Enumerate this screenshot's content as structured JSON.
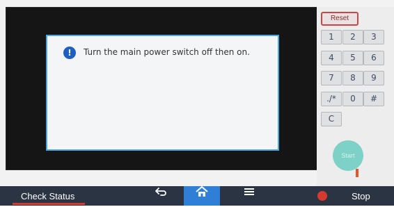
{
  "dialog": {
    "message": "Turn the main power switch off then on."
  },
  "keypad": {
    "reset_label": "Reset",
    "keys": [
      "1",
      "2",
      "3",
      "4",
      "5",
      "6",
      "7",
      "8",
      "9",
      "./*",
      "0",
      "#",
      "C"
    ],
    "start_label": "Start"
  },
  "bottom_bar": {
    "check_status_label": "Check Status",
    "back_icon": "back-arrow-icon",
    "home_icon": "home-icon",
    "menu_icon": "menu-icon",
    "stop_label": "Stop"
  },
  "colors": {
    "accent_blue": "#2f7fd6",
    "stop_red": "#d63a2f",
    "start_teal": "#7ed1c6",
    "bar_bg": "#2a3443"
  }
}
